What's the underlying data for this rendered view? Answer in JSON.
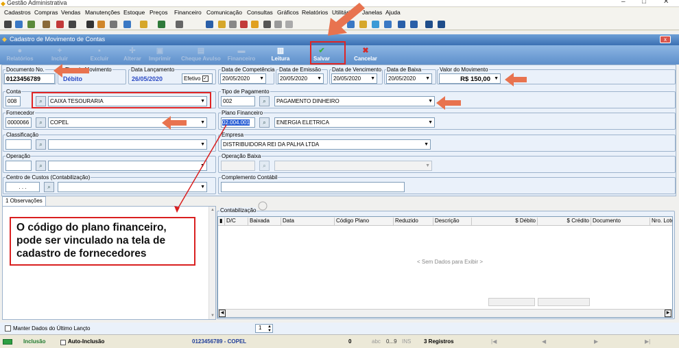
{
  "window": {
    "title": "Gestão Administrativa",
    "min": "–",
    "max": "□",
    "close": "✕"
  },
  "menu": [
    "Cadastros",
    "Compras",
    "Vendas",
    "Manutenções",
    "Estoque",
    "Preços",
    "Financeiro",
    "Comunicação",
    "Consultas",
    "Gráficos",
    "Relatórios",
    "Utilitários",
    "Janelas",
    "Ajuda"
  ],
  "child": {
    "title": "Cadastro de Movimento de Contas",
    "close": "x"
  },
  "ribbon": [
    {
      "label": "Relatórios",
      "enabled": false
    },
    {
      "label": "Incluir",
      "enabled": false
    },
    {
      "label": "Excluir",
      "enabled": false
    },
    {
      "label": "Alterar",
      "enabled": false
    },
    {
      "label": "Imprimir",
      "enabled": false
    },
    {
      "label": "Cheque Avulso",
      "enabled": false
    },
    {
      "label": "Financeiro",
      "enabled": false
    },
    {
      "label": "Leitura",
      "enabled": true
    },
    {
      "label": "Salvar",
      "enabled": true
    },
    {
      "label": "Cancelar",
      "enabled": true
    }
  ],
  "form": {
    "documento": {
      "label": "Documento No.",
      "value": "0123456789"
    },
    "tipo": {
      "label": "Tipo do Movimento",
      "value": "Débito"
    },
    "lancamento": {
      "label": "Data Lançamento",
      "value": "26/05/2020"
    },
    "efetivo": {
      "label": "Efetivo",
      "checked": "✓"
    },
    "competencia": {
      "label": "Data de Competência",
      "value": "20/05/2020"
    },
    "emissao": {
      "label": "Data de Emissão",
      "value": "20/05/2020"
    },
    "vencimento": {
      "label": "Data de Vencimento",
      "value": "20/05/2020"
    },
    "baixa": {
      "label": "Data de Baixa",
      "value": "20/05/2020"
    },
    "valor": {
      "label": "Valor do Movimento",
      "value": "R$ 150,00"
    },
    "conta": {
      "label": "Conta",
      "code": "008",
      "value": "CAIXA TESOURARIA"
    },
    "tipopag": {
      "label": "Tipo de Pagamento",
      "code": "002",
      "value": "PAGAMENTO DINHEIRO"
    },
    "fornecedor": {
      "label": "Fornecedor",
      "code": "0000066",
      "value": "COPEL"
    },
    "plano": {
      "label": "Plano Financeiro",
      "code": "02.004.001",
      "value": "ENERGIA ELETRICA"
    },
    "classificacao": {
      "label": "Classificação"
    },
    "empresa": {
      "label": "Empresa",
      "value": "DISTRIBUIDORA REI DA PALHA LTDA"
    },
    "operacao": {
      "label": "Operação"
    },
    "opbaixa": {
      "label": "Operação Baixa"
    },
    "centro": {
      "label": "Centro de Custos (Contabilização)",
      "code": ". . ."
    },
    "complemento": {
      "label": "Complemento Contábil"
    }
  },
  "tabs": {
    "obs": "1 Observações"
  },
  "contab": {
    "label": "Contabilização",
    "columns": [
      "D/C",
      "Baixada",
      "Data",
      "Código Plano",
      "Reduzido",
      "Descrição",
      "$ Débito",
      "$ Crédito",
      "Documento",
      "Nro. Lote"
    ],
    "empty": "< Sem Dados para Exibir >"
  },
  "annotation": "O código do plano financeiro, pode ser vinculado na tela de cadastro de fornecedores",
  "manter": {
    "label": "Manter Dados do Último Lançto",
    "spin": "1"
  },
  "status": {
    "mode": "Inclusão",
    "auto": "Auto-Inclusão",
    "doc": "0123456789 - COPEL",
    "count": "0",
    "abc": "abc",
    "num": "0...9",
    "ins": "INS",
    "records": "3 Registros"
  }
}
